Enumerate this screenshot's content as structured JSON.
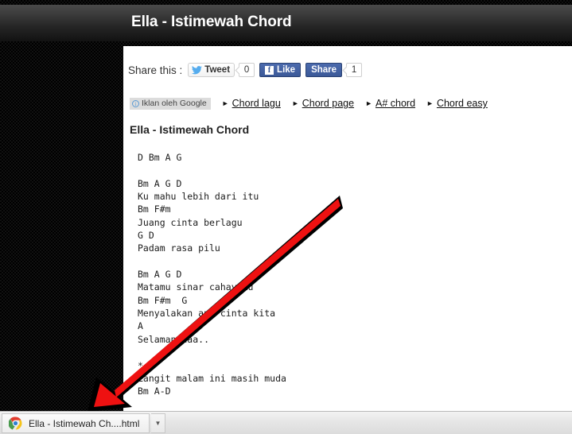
{
  "window": {
    "header_title": "Ella - Istimewah Chord"
  },
  "share": {
    "label": "Share this :",
    "tweet_label": "Tweet",
    "tweet_count": "0",
    "twitter_icon": "twitter-bird-icon",
    "like_label": "Like",
    "facebook_icon": "facebook-f-icon",
    "share_label": "Share",
    "share_count": "1"
  },
  "ads": {
    "badge_label": "Iklan oleh Google",
    "info_icon": "info-circle-icon",
    "info_glyph": "i",
    "bullet_glyph": "►",
    "links": [
      {
        "label": "Chord lagu"
      },
      {
        "label": "Chord page"
      },
      {
        "label": "A# chord"
      },
      {
        "label": "Chord easy"
      }
    ]
  },
  "content": {
    "title": "Ella - Istimewah Chord",
    "chord_text": "D Bm A G\n\nBm A G D\nKu mahu lebih dari itu\nBm F#m\nJuang cinta berlagu\nG D\nPadam rasa pilu\n\nBm A G D\nMatamu sinar cahayaku\nBm F#m  G\nMenyalakan api cinta kita\nA\nSelamanyaaa..\n\n*\nLangit malam ini masih muda\nBm A-D"
  },
  "annotation": {
    "arrow_name": "red-annotation-arrow",
    "arrow_color": "#ee1111",
    "arrow_outline_color": "#000000",
    "arrow_tip": "112,516",
    "arrow_tail": "428,248"
  },
  "taskbar": {
    "task_label": "Ella - Istimewah Ch....html",
    "chrome_icon": "chrome-icon",
    "overflow_glyph": "▼"
  }
}
